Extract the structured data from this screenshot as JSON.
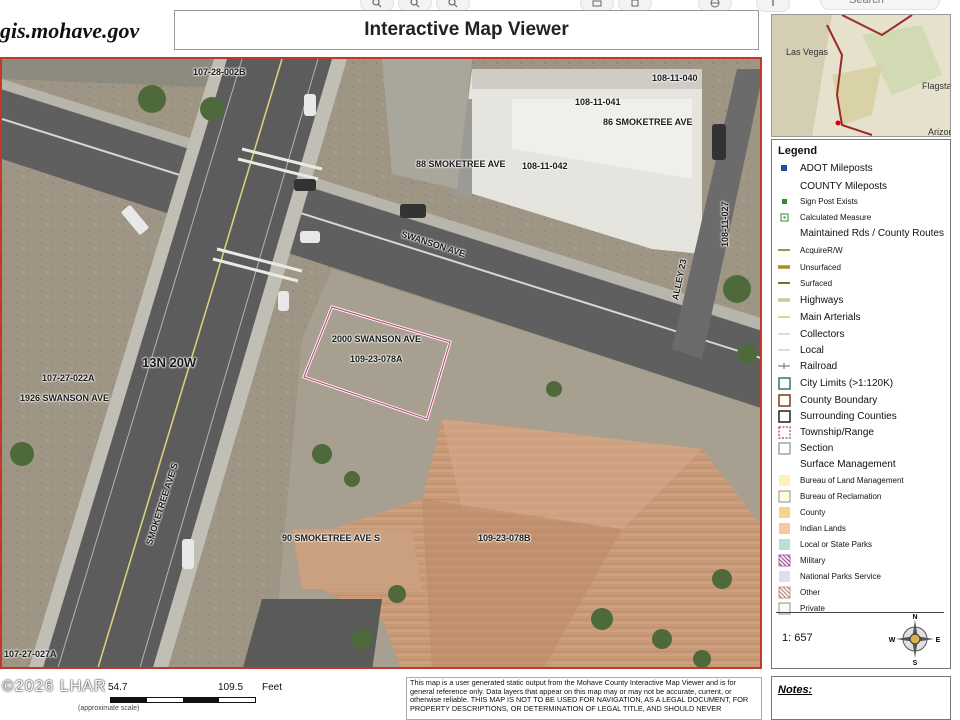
{
  "header": {
    "site_url": "gis.mohave.gov",
    "title": "Interactive Map Viewer",
    "toolbar_search_placeholder": "Search"
  },
  "map": {
    "labels": {
      "p_107_28_002b": "107-28-002B",
      "p_108_11_040": "108-11-040",
      "p_108_11_041": "108-11-041",
      "addr_86_smoketree": "86 SMOKETREE AVE",
      "addr_88_smoketree": "88 SMOKETREE AVE",
      "p_108_11_042": "108-11-042",
      "p_108_11_027": "108-11-027",
      "street_swanson": "SWANSON AVE",
      "street_alley": "ALLEY 23",
      "addr_2000_swanson": "2000 SWANSON AVE",
      "p_109_23_078a": "109-23-078A",
      "township": "13N 20W",
      "p_107_27_022a": "107-27-022A",
      "addr_1926_swanson": "1926 SWANSON AVE",
      "street_smoketree_s": "SMOKETREE AVE S",
      "addr_90_smoketree_s": "90 SMOKETREE AVE S",
      "p_109_23_078b": "109-23-078B",
      "p_107_27_027a": "107-27-027A"
    }
  },
  "inset": {
    "city1": "Las Vegas",
    "city2": "Flagsta",
    "city3": "Arizon"
  },
  "legend": {
    "title": "Legend",
    "items": [
      {
        "label": "ADOT Mileposts",
        "symbol": "square-blue",
        "color": "#1f4e9c"
      },
      {
        "label": "COUNTY Mileposts",
        "symbol": "none"
      },
      {
        "label": "Sign Post Exists",
        "symbol": "square-green",
        "color": "#2e8b2e",
        "small": true
      },
      {
        "label": "Calculated Measure",
        "symbol": "square-green-outline",
        "color": "#2e8b2e",
        "small": true
      },
      {
        "label": "Maintained Rds / County Routes",
        "symbol": "none"
      },
      {
        "label": "AcquireR/W",
        "symbol": "line",
        "color": "#7fa34a",
        "small": true
      },
      {
        "label": "Unsurfaced",
        "symbol": "line-thick",
        "color": "#b5842c",
        "small": true
      },
      {
        "label": "Surfaced",
        "symbol": "line",
        "color": "#8a6a2a",
        "small": true
      },
      {
        "label": "Highways",
        "symbol": "line-thick",
        "color": "#cfc79a"
      },
      {
        "label": "Main Arterials",
        "symbol": "line",
        "color": "#d9d3a8"
      },
      {
        "label": "Collectors",
        "symbol": "line",
        "color": "#e4dfbf"
      },
      {
        "label": "Local",
        "symbol": "line-thin",
        "color": "#bbbbbb"
      },
      {
        "label": "Railroad",
        "symbol": "railroad",
        "color": "#666666"
      },
      {
        "label": "City Limits (>1:120K)",
        "symbol": "box",
        "color": "#2f7a6a"
      },
      {
        "label": "County Boundary",
        "symbol": "box",
        "color": "#7a3a1a"
      },
      {
        "label": "Surrounding Counties",
        "symbol": "box",
        "color": "#222222"
      },
      {
        "label": "Township/Range",
        "symbol": "box-dashed",
        "color": "#a0405a"
      },
      {
        "label": "Section",
        "symbol": "box",
        "color": "#9aa8b0"
      },
      {
        "label": "Surface Management",
        "symbol": "none"
      },
      {
        "label": "Bureau of Land Management",
        "symbol": "fill",
        "color": "#fdf0b8",
        "small": true
      },
      {
        "label": "Bureau of Reclamation",
        "symbol": "fill-outline",
        "color": "#fffbe0",
        "small": true
      },
      {
        "label": "County",
        "symbol": "fill",
        "color": "#f5d58a",
        "small": true
      },
      {
        "label": "Indian Lands",
        "symbol": "fill",
        "color": "#f2c9a0",
        "small": true
      },
      {
        "label": "Local or State Parks",
        "symbol": "fill",
        "color": "#b8e0d8",
        "small": true
      },
      {
        "label": "Military",
        "symbol": "hatch",
        "color": "#a04a9a",
        "small": true
      },
      {
        "label": "National Parks Service",
        "symbol": "fill",
        "color": "#e0dcf4",
        "small": true
      },
      {
        "label": "Other",
        "symbol": "hatch",
        "color": "#b08a7a",
        "small": true
      },
      {
        "label": "Private",
        "symbol": "fill-outline",
        "color": "#fafaf6",
        "small": true
      }
    ],
    "scale": "1: 657",
    "compass": {
      "n": "N",
      "s": "S",
      "e": "E",
      "w": "W"
    }
  },
  "footer": {
    "copyright": "©2026 LHAR",
    "scale_first": "54.7",
    "scale_second": "109.5",
    "scale_unit": "Feet",
    "scale_note": "(approximate scale)",
    "disclaimer": "This map is a user generated static output from the Mohave County Interactive Map Viewer and is for general reference only. Data layers that appear on this map may or may not be accurate, current, or otherwise reliable. THIS MAP IS NOT TO BE USED FOR NAVIGATION, AS A LEGAL DOCUMENT, FOR PROPERTY DESCRIPTIONS, OR DETERMINATION OF LEGAL TITLE, AND SHOULD NEVER",
    "notes_label": "Notes:"
  }
}
